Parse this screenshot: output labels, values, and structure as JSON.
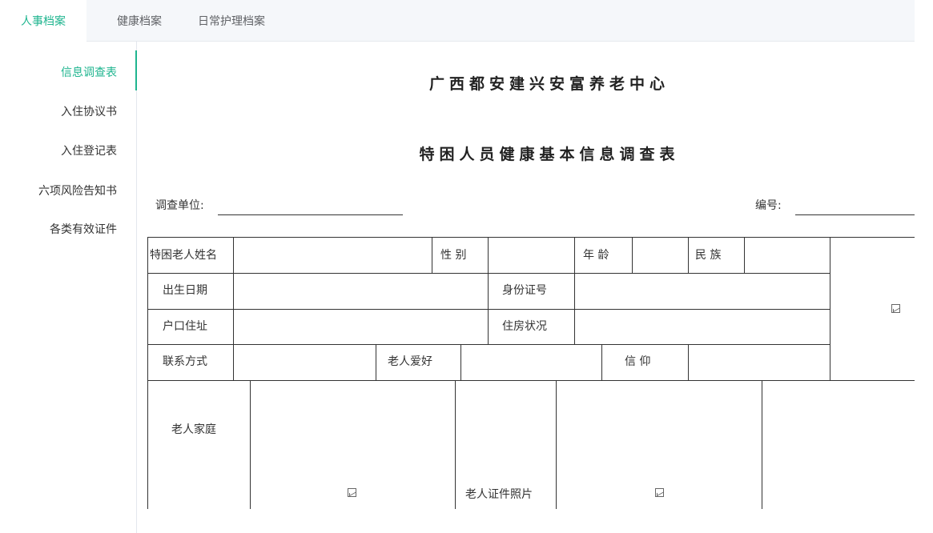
{
  "tabs": [
    {
      "label": "人事档案",
      "active": true
    },
    {
      "label": "健康档案",
      "active": false
    },
    {
      "label": "日常护理档案",
      "active": false
    }
  ],
  "sidebar": {
    "items": [
      {
        "label": "信息调查表",
        "active": true
      },
      {
        "label": "入住协议书",
        "active": false
      },
      {
        "label": "入住登记表",
        "active": false
      },
      {
        "label": "六项风险告知书",
        "active": false
      },
      {
        "label": "各类有效证件",
        "active": false
      }
    ]
  },
  "doc": {
    "org_title": "广西都安建兴安富养老中心",
    "form_title": "特困人员健康基本信息调查表",
    "unit_label": "调查单位:",
    "number_label": "编号:",
    "fields": {
      "name": "特困老人姓名",
      "gender": "性  别",
      "age": "年  龄",
      "ethnicity": "民  族",
      "birth_date": "出生日期",
      "id_number": "身份证号",
      "household_address": "户口住址",
      "housing": "住房状况",
      "contact": "联系方式",
      "hobby": "老人爱好",
      "belief": "信  仰",
      "family": "老人家庭",
      "id_photo": "老人证件照片"
    }
  },
  "colors": {
    "accent": "#1fb58f",
    "tab_bar_bg": "#f5f7fa",
    "text": "#333333"
  },
  "icons": {
    "photo_placeholder": "broken-image-icon"
  }
}
